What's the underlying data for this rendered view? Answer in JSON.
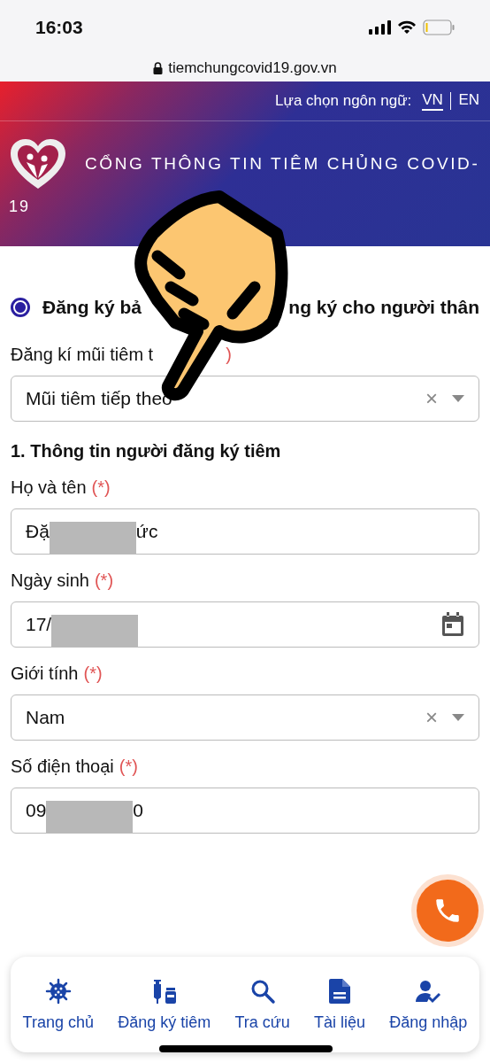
{
  "status_bar": {
    "time": "16:03"
  },
  "address_bar": {
    "url": "tiemchungcovid19.gov.vn"
  },
  "header": {
    "language_label": "Lựa chọn ngôn ngữ:",
    "languages": [
      {
        "label": "VN",
        "selected": true
      },
      {
        "label": "EN",
        "selected": false
      }
    ],
    "title_line_1": "CỔNG THÔNG TIN TIÊM CHỦNG COVID-",
    "title_line_2": "19"
  },
  "registration_type": {
    "selected_option": {
      "label": "Đăng ký bả",
      "selected": true
    },
    "second_option_visible": "ng ký cho người thân"
  },
  "dose_field": {
    "label": "Đăng kí mũi tiêm t",
    "required_mark": ")",
    "value": "Mũi tiêm tiếp theo",
    "clear_glyph": "×"
  },
  "section_title": "1. Thông tin người đăng ký tiêm",
  "fields": [
    {
      "kind": "text",
      "label": "Họ và tên",
      "required_mark": "(*)",
      "value_start": "Đặ",
      "value_end": "ức",
      "redacted": true
    },
    {
      "kind": "date",
      "label": "Ngày sinh",
      "required_mark": "(*)",
      "value_start": "17/",
      "redacted": true
    },
    {
      "kind": "select",
      "label": "Giới tính",
      "required_mark": "(*)",
      "value_start": "Nam",
      "clear_glyph": "×"
    },
    {
      "kind": "text",
      "label": "Số điện thoại",
      "required_mark": "(*)",
      "value_start": "09",
      "value_end": "0",
      "redacted": true
    }
  ],
  "bottom_nav": [
    {
      "label": "Trang chủ"
    },
    {
      "label": "Đăng ký tiêm"
    },
    {
      "label": "Tra cứu"
    },
    {
      "label": "Tài liệu"
    },
    {
      "label": "Đăng nhập"
    }
  ]
}
